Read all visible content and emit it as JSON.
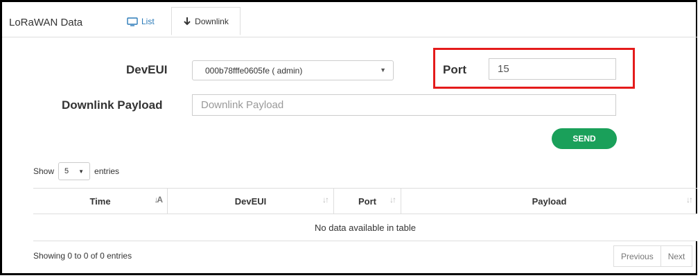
{
  "app": {
    "title": "LoRaWAN Data"
  },
  "tabs": [
    {
      "label": "List",
      "icon": "monitor-icon"
    },
    {
      "label": "Downlink",
      "icon": "arrow-down-icon"
    }
  ],
  "form": {
    "deveui_label": "DevEUI",
    "deveui_value": "000b78fffe0605fe ( admin)",
    "port_label": "Port",
    "port_value": "15",
    "payload_label": "Downlink Payload",
    "payload_placeholder": "Downlink Payload",
    "payload_value": "",
    "send_label": "SEND"
  },
  "length_control": {
    "prefix": "Show",
    "value": "5",
    "suffix": "entries"
  },
  "table": {
    "columns": [
      "Time",
      "DevEUI",
      "Port",
      "Payload"
    ],
    "empty_message": "No data available in table"
  },
  "footer": {
    "info": "Showing 0 to 0 of 0 entries",
    "previous": "Previous",
    "next": "Next"
  },
  "colors": {
    "accent": "#1aa05a",
    "highlight": "#e41b1b",
    "link": "#2a7ab8"
  }
}
